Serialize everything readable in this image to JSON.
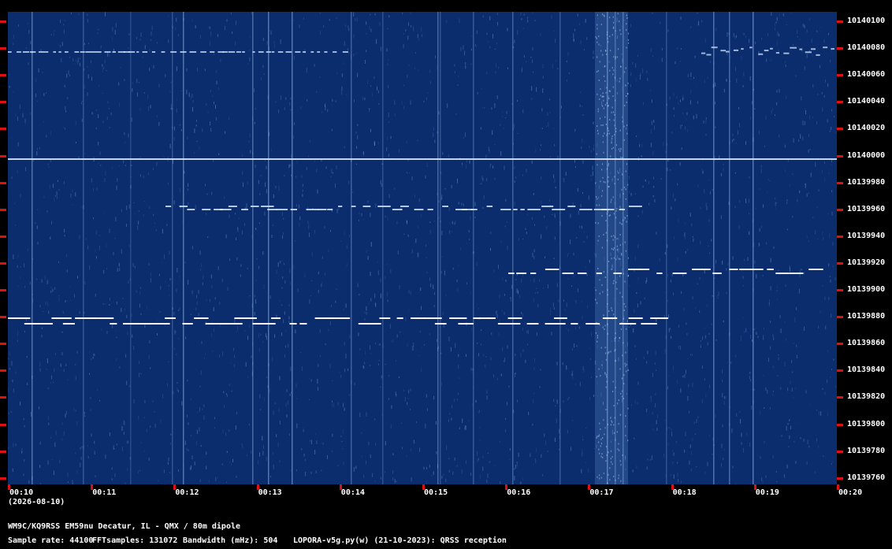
{
  "colors": {
    "background": "#0b2d6e",
    "signal": "#ffffff",
    "tick": "#e01010",
    "text": "#ffffff"
  },
  "freq_axis": {
    "labels": [
      "10140100",
      "10140080",
      "10140060",
      "10140040",
      "10140020",
      "10140000",
      "10139980",
      "10139960",
      "10139940",
      "10139920",
      "10139900",
      "10139880",
      "10139860",
      "10139840",
      "10139820",
      "10139800",
      "10139780",
      "10139760"
    ]
  },
  "time_axis": {
    "labels": [
      "00:10",
      "00:11",
      "00:12",
      "00:13",
      "00:14",
      "00:15",
      "00:16",
      "00:17",
      "00:18",
      "00:19",
      "00:20"
    ],
    "date": "(2026-08-10)"
  },
  "footer": {
    "station": "WM9C/KQ9RSS EM59nu Decatur, IL - QMX / 80m dipole",
    "sample_rate": "Sample rate: 44100",
    "fft_samples": "FFTsamples: 131072",
    "bandwidth": "Bandwidth (mHz): 504",
    "software": "LOPORA-v5g.py(w) (21-10-2023): QRSS reception"
  }
}
